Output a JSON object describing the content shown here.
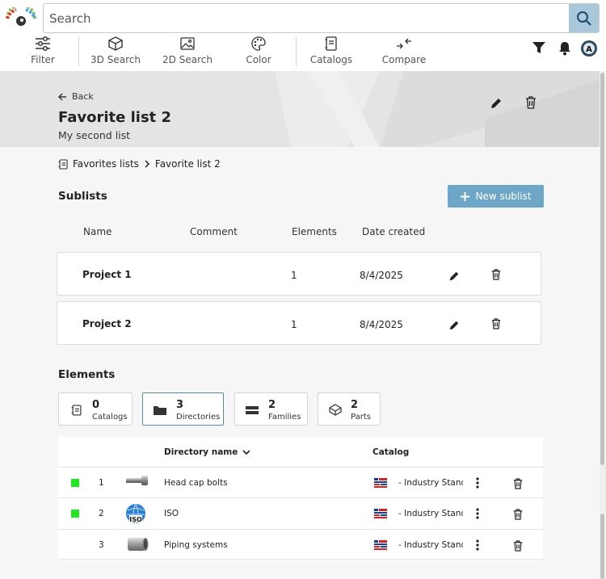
{
  "search": {
    "placeholder": "Search"
  },
  "toolbar": {
    "items": [
      {
        "label": "Filter",
        "icon": "sliders-icon"
      },
      {
        "label": "3D Search",
        "icon": "cube-icon"
      },
      {
        "label": "2D Search",
        "icon": "image-icon"
      },
      {
        "label": "Color",
        "icon": "palette-icon"
      },
      {
        "label": "Catalogs",
        "icon": "catalog-icon"
      },
      {
        "label": "Compare",
        "icon": "compare-icon"
      }
    ],
    "right": [
      "funnel-icon",
      "bell-icon",
      "user-avatar"
    ]
  },
  "page": {
    "back_label": "Back",
    "title": "Favorite list 2",
    "subtitle": "My second list"
  },
  "breadcrumb": {
    "items": [
      "Favorites lists",
      "Favorite list 2"
    ]
  },
  "sublists": {
    "heading": "Sublists",
    "new_button": "New sublist",
    "columns": [
      "Name",
      "Comment",
      "Elements",
      "Date created"
    ],
    "rows": [
      {
        "name": "Project 1",
        "comment": "",
        "elements": "1",
        "date": "8/4/2025"
      },
      {
        "name": "Project 2",
        "comment": "",
        "elements": "1",
        "date": "8/4/2025"
      }
    ]
  },
  "elements": {
    "heading": "Elements",
    "filters": [
      {
        "count": "0",
        "label": "Catalogs",
        "icon": "catalog-icon",
        "active": false
      },
      {
        "count": "3",
        "label": "Directories",
        "icon": "folder-icon",
        "active": true
      },
      {
        "count": "2",
        "label": "Families",
        "icon": "families-icon",
        "active": false
      },
      {
        "count": "2",
        "label": "Parts",
        "icon": "part-icon",
        "active": false
      }
    ],
    "table": {
      "col_name": "Directory name",
      "col_catalog": "Catalog",
      "rows": [
        {
          "num": "1",
          "name": "Head cap bolts",
          "catalog": "- Industry Standards",
          "status": true,
          "thumb": "bolt"
        },
        {
          "num": "2",
          "name": "ISO",
          "catalog": "- Industry Standards",
          "status": true,
          "thumb": "iso"
        },
        {
          "num": "3",
          "name": "Piping systems",
          "catalog": "- Industry Standards",
          "status": false,
          "thumb": "pipe"
        }
      ]
    }
  },
  "colors": {
    "accent": "#6ea6c7",
    "status_green": "#22e622",
    "search_button": "#a9c8dc"
  }
}
